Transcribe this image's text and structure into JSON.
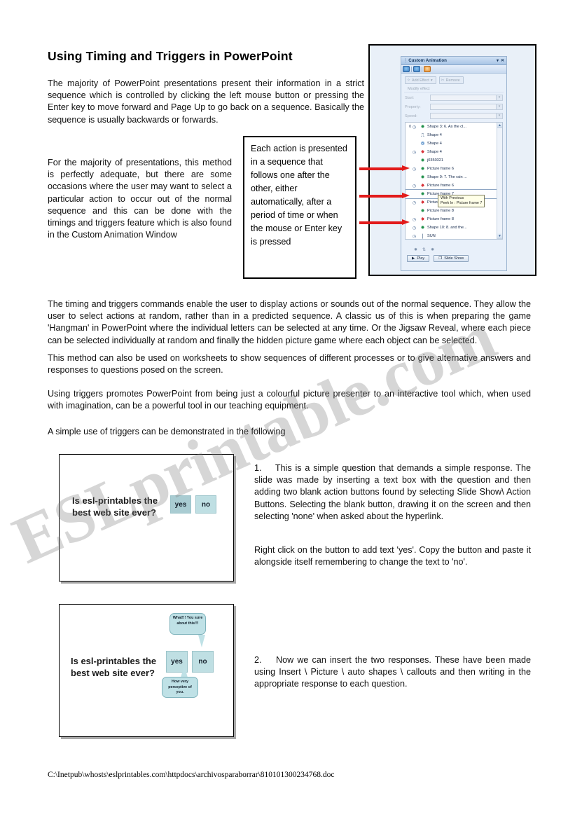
{
  "document": {
    "title": "Using Timing and Triggers in PowerPoint",
    "paragraphs": {
      "p1": "The majority of PowerPoint presentations present their information in a strict sequence which is controlled by clicking the left mouse button or pressing the Enter key to move forward and Page Up to go back on a sequence.  Basically the sequence is usually backwards or forwards.",
      "p2": "For the majority of presentations, this method is perfectly adequate, but there are some occasions where the user may want to select a particular action to occur out of the normal sequence and this can be done with the timings and triggers feature which is also found in the Custom Animation Window",
      "p3": "The timing and triggers commands enable the user to display actions or sounds out of the normal sequence.  They allow the user to select actions at random, rather than in a predicted sequence.  A classic us of this is when preparing the game 'Hangman' in PowerPoint where the individual letters can be selected at any time.  Or the Jigsaw Reveal, where each piece can be selected individually at random and finally the hidden picture game where each object can be selected.",
      "p4": "This method can also be used on worksheets to show sequences of different processes or to give alternative answers and responses to questions posed on the screen.",
      "p5": "Using triggers promotes PowerPoint from being just a colourful picture presenter to an interactive tool which, when used with imagination, can be a powerful tool in our teaching equipment.",
      "p6": "A simple use of triggers can be demonstrated in the following",
      "step1": "1.    This is a simple question that demands a simple response.  The slide was made by inserting a text box with the question and then adding two blank action buttons found by selecting Slide Show\\ Action Buttons.  Selecting the blank button, drawing it on the screen and then selecting 'none' when asked about the hyperlink.",
      "step1b": "Right click on the button to add text 'yes'.  Copy the button and paste it alongside itself remembering to change the text to 'no'.",
      "step2": "2.    Now we can insert the two responses.  These have been made using Insert \\ Picture \\ auto shapes \\ callouts and then writing in the appropriate response to each question."
    },
    "callout_box": "Each action is presented in a sequence that follows one after the other, either automatically, after a period of time or when the mouse or Enter key is pressed",
    "footer_path": "C:\\Inetpub\\whosts\\eslprintables.com\\httpdocs\\archivosparaborrar\\810101300234768.doc",
    "watermark": "ESLprintable.com"
  },
  "custom_animation": {
    "panel_title": "Custom Animation",
    "titlebar_buttons": [
      "▾",
      "✕"
    ],
    "nav_buttons": [
      "back-arrow-icon",
      "forward-arrow-icon",
      "home-icon"
    ],
    "toolbar": {
      "add_effect": "Add Effect",
      "add_effect_arrow": "▾",
      "remove": "Remove"
    },
    "modify_effect_label": "Modify effect",
    "fields": [
      {
        "label": "Start:",
        "value": ""
      },
      {
        "label": "Property:",
        "value": ""
      },
      {
        "label": "Speed:",
        "value": ""
      }
    ],
    "list_items": [
      {
        "num": "0",
        "clock": "◷",
        "icon": "✹",
        "icon_color": "green",
        "label": "Shape 3: 6.  As the cl..."
      },
      {
        "num": "",
        "clock": "",
        "icon": "⎍",
        "icon_color": "dark",
        "label": "Shape 4"
      },
      {
        "num": "",
        "clock": "",
        "icon": "❁",
        "icon_color": "blue",
        "label": "Shape 4"
      },
      {
        "num": "",
        "clock": "◷",
        "icon": "✸",
        "icon_color": "red",
        "label": "Shape 4"
      },
      {
        "num": "",
        "clock": "",
        "icon": "✹",
        "icon_color": "green",
        "label": "j0350321"
      },
      {
        "num": "",
        "clock": "◷",
        "icon": "✹",
        "icon_color": "green",
        "label": "Picture frame 6"
      },
      {
        "num": "",
        "clock": "",
        "icon": "✹",
        "icon_color": "green",
        "label": "Shape 9: 7.  The rain ..."
      },
      {
        "num": "",
        "clock": "◷",
        "icon": "✸",
        "icon_color": "red",
        "label": "Picture frame 6"
      },
      {
        "num": "",
        "clock": "",
        "icon": "✹",
        "icon_color": "green",
        "label": "Picture frame 7",
        "selected": true
      },
      {
        "num": "",
        "clock": "◷",
        "icon": "✸",
        "icon_color": "red",
        "label": "Picture frame 7"
      },
      {
        "num": "",
        "clock": "",
        "icon": "✹",
        "icon_color": "green",
        "label": "Picture frame 8"
      },
      {
        "num": "",
        "clock": "◷",
        "icon": "✸",
        "icon_color": "red",
        "label": "Picture frame 8"
      },
      {
        "num": "",
        "clock": "◷",
        "icon": "✹",
        "icon_color": "green",
        "label": "Shape 10: 8.  and the..."
      },
      {
        "num": "",
        "clock": "◷",
        "icon": "❘",
        "icon_color": "dark",
        "label": "SUN"
      }
    ],
    "tooltip": {
      "line1": "With Previous",
      "line2": "Peek In : Picture frame 7"
    },
    "scroll_up": "▲",
    "scroll_down": "▼",
    "bottom_buttons": {
      "play": "Play",
      "play_icon": "▶",
      "slide_show": "Slide Show",
      "slide_show_icon": "❐"
    }
  },
  "slide_examples": [
    {
      "name": "slide-question-only",
      "question": "Is esl-printables the best web site ever?",
      "buttons": [
        {
          "label": "yes"
        },
        {
          "label": "no"
        }
      ]
    },
    {
      "name": "slide-with-callouts",
      "question": "Is esl-printables the best web site ever?",
      "buttons": [
        {
          "label": "yes"
        },
        {
          "label": "no"
        }
      ],
      "callouts": [
        {
          "position": "top",
          "text": "What!!! You sure about this!!!"
        },
        {
          "position": "bottom",
          "text": "How very perceptive of you."
        }
      ]
    }
  ],
  "colors": {
    "arrow_red": "#e21b1b",
    "panel_blue": "#e8f0fa",
    "button_teal": "#bfdfe3",
    "callout_teal": "#bfe1e6"
  }
}
